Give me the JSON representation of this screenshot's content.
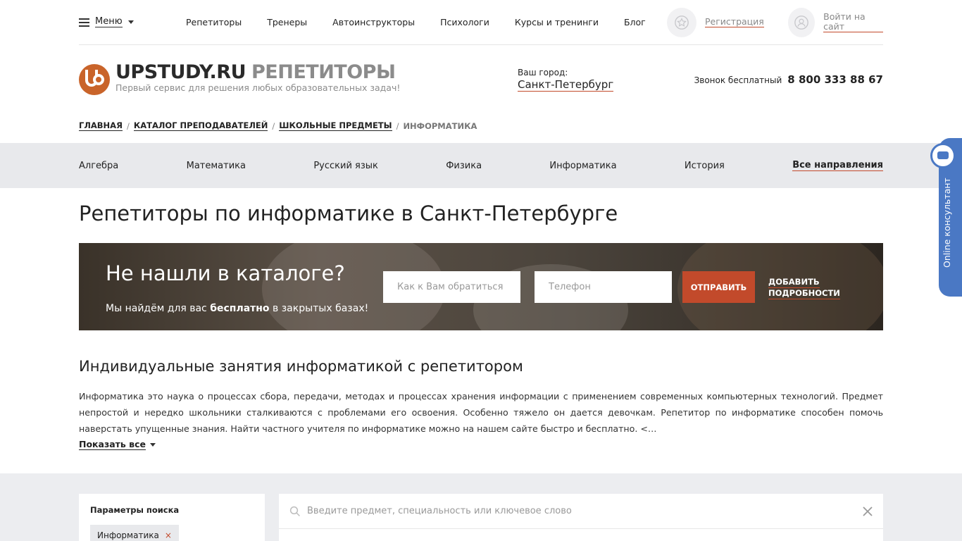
{
  "topnav": {
    "menu_label": "Меню",
    "links": [
      "Репетиторы",
      "Тренеры",
      "Автоинструкторы",
      "Психологи",
      "Курсы и тренинги",
      "Блог"
    ],
    "register_label": "Регистрация",
    "login_label": "Войти на сайт"
  },
  "header": {
    "logo_main": "UPSTUDY.RU",
    "logo_section": "РЕПЕТИТОРЫ",
    "tagline": "Первый сервис для решения любых образовательных задач!",
    "city_label": "Ваш город:",
    "city_value": "Санкт-Петербург",
    "phone_label": "Звонок бесплатный",
    "phone_number": "8 800 333 88 67"
  },
  "breadcrumb": {
    "items": [
      "Главная",
      "Каталог преподавателей",
      "Школьные предметы"
    ],
    "current": "Информатика"
  },
  "subjects": [
    "Алгебра",
    "Математика",
    "Русский язык",
    "Физика",
    "Информатика",
    "История"
  ],
  "subjects_all": "Все направления",
  "page_title": "Репетиторы по информатике в Санкт-Петербурге",
  "banner": {
    "title": "Не нашли в каталоге?",
    "sub_before": "Мы найдём для вас ",
    "sub_bold": "бесплатно",
    "sub_after": " в закрытых базах!",
    "name_placeholder": "Как к Вам обратиться",
    "phone_placeholder": "Телефон",
    "send_label": "ОТПРАВИТЬ",
    "add_details_line1": "ДОБАВИТЬ",
    "add_details_line2": "ПОДРОБНОСТИ"
  },
  "intro": {
    "title": "Индивидуальные занятия информатикой с репетитором",
    "text": "Информатика это наука о процессах сбора, передачи, методах и процессах хранения информации с применением современных компьютерных технологий. Предмет непростой и нередко школьники сталкиваются с проблемами его освоения. Особенно тяжело он дается девочкам. Репетитор по информатике способен помочь наверстать упущенные знания. Найти частного учителя по информатике можно на нашем сайте быстро и бесплатно. <…",
    "show_all": "Показать все"
  },
  "filters": {
    "title": "Параметры поиска",
    "tag": "Информатика",
    "tag_remove": "×"
  },
  "search": {
    "placeholder": "Введите предмет, специальность или ключевое слово"
  },
  "consultant": {
    "label": "Online консультант"
  },
  "colors": {
    "accent": "#c24a2b",
    "consultant": "#4a78c4",
    "band": "#e8e9ec"
  }
}
